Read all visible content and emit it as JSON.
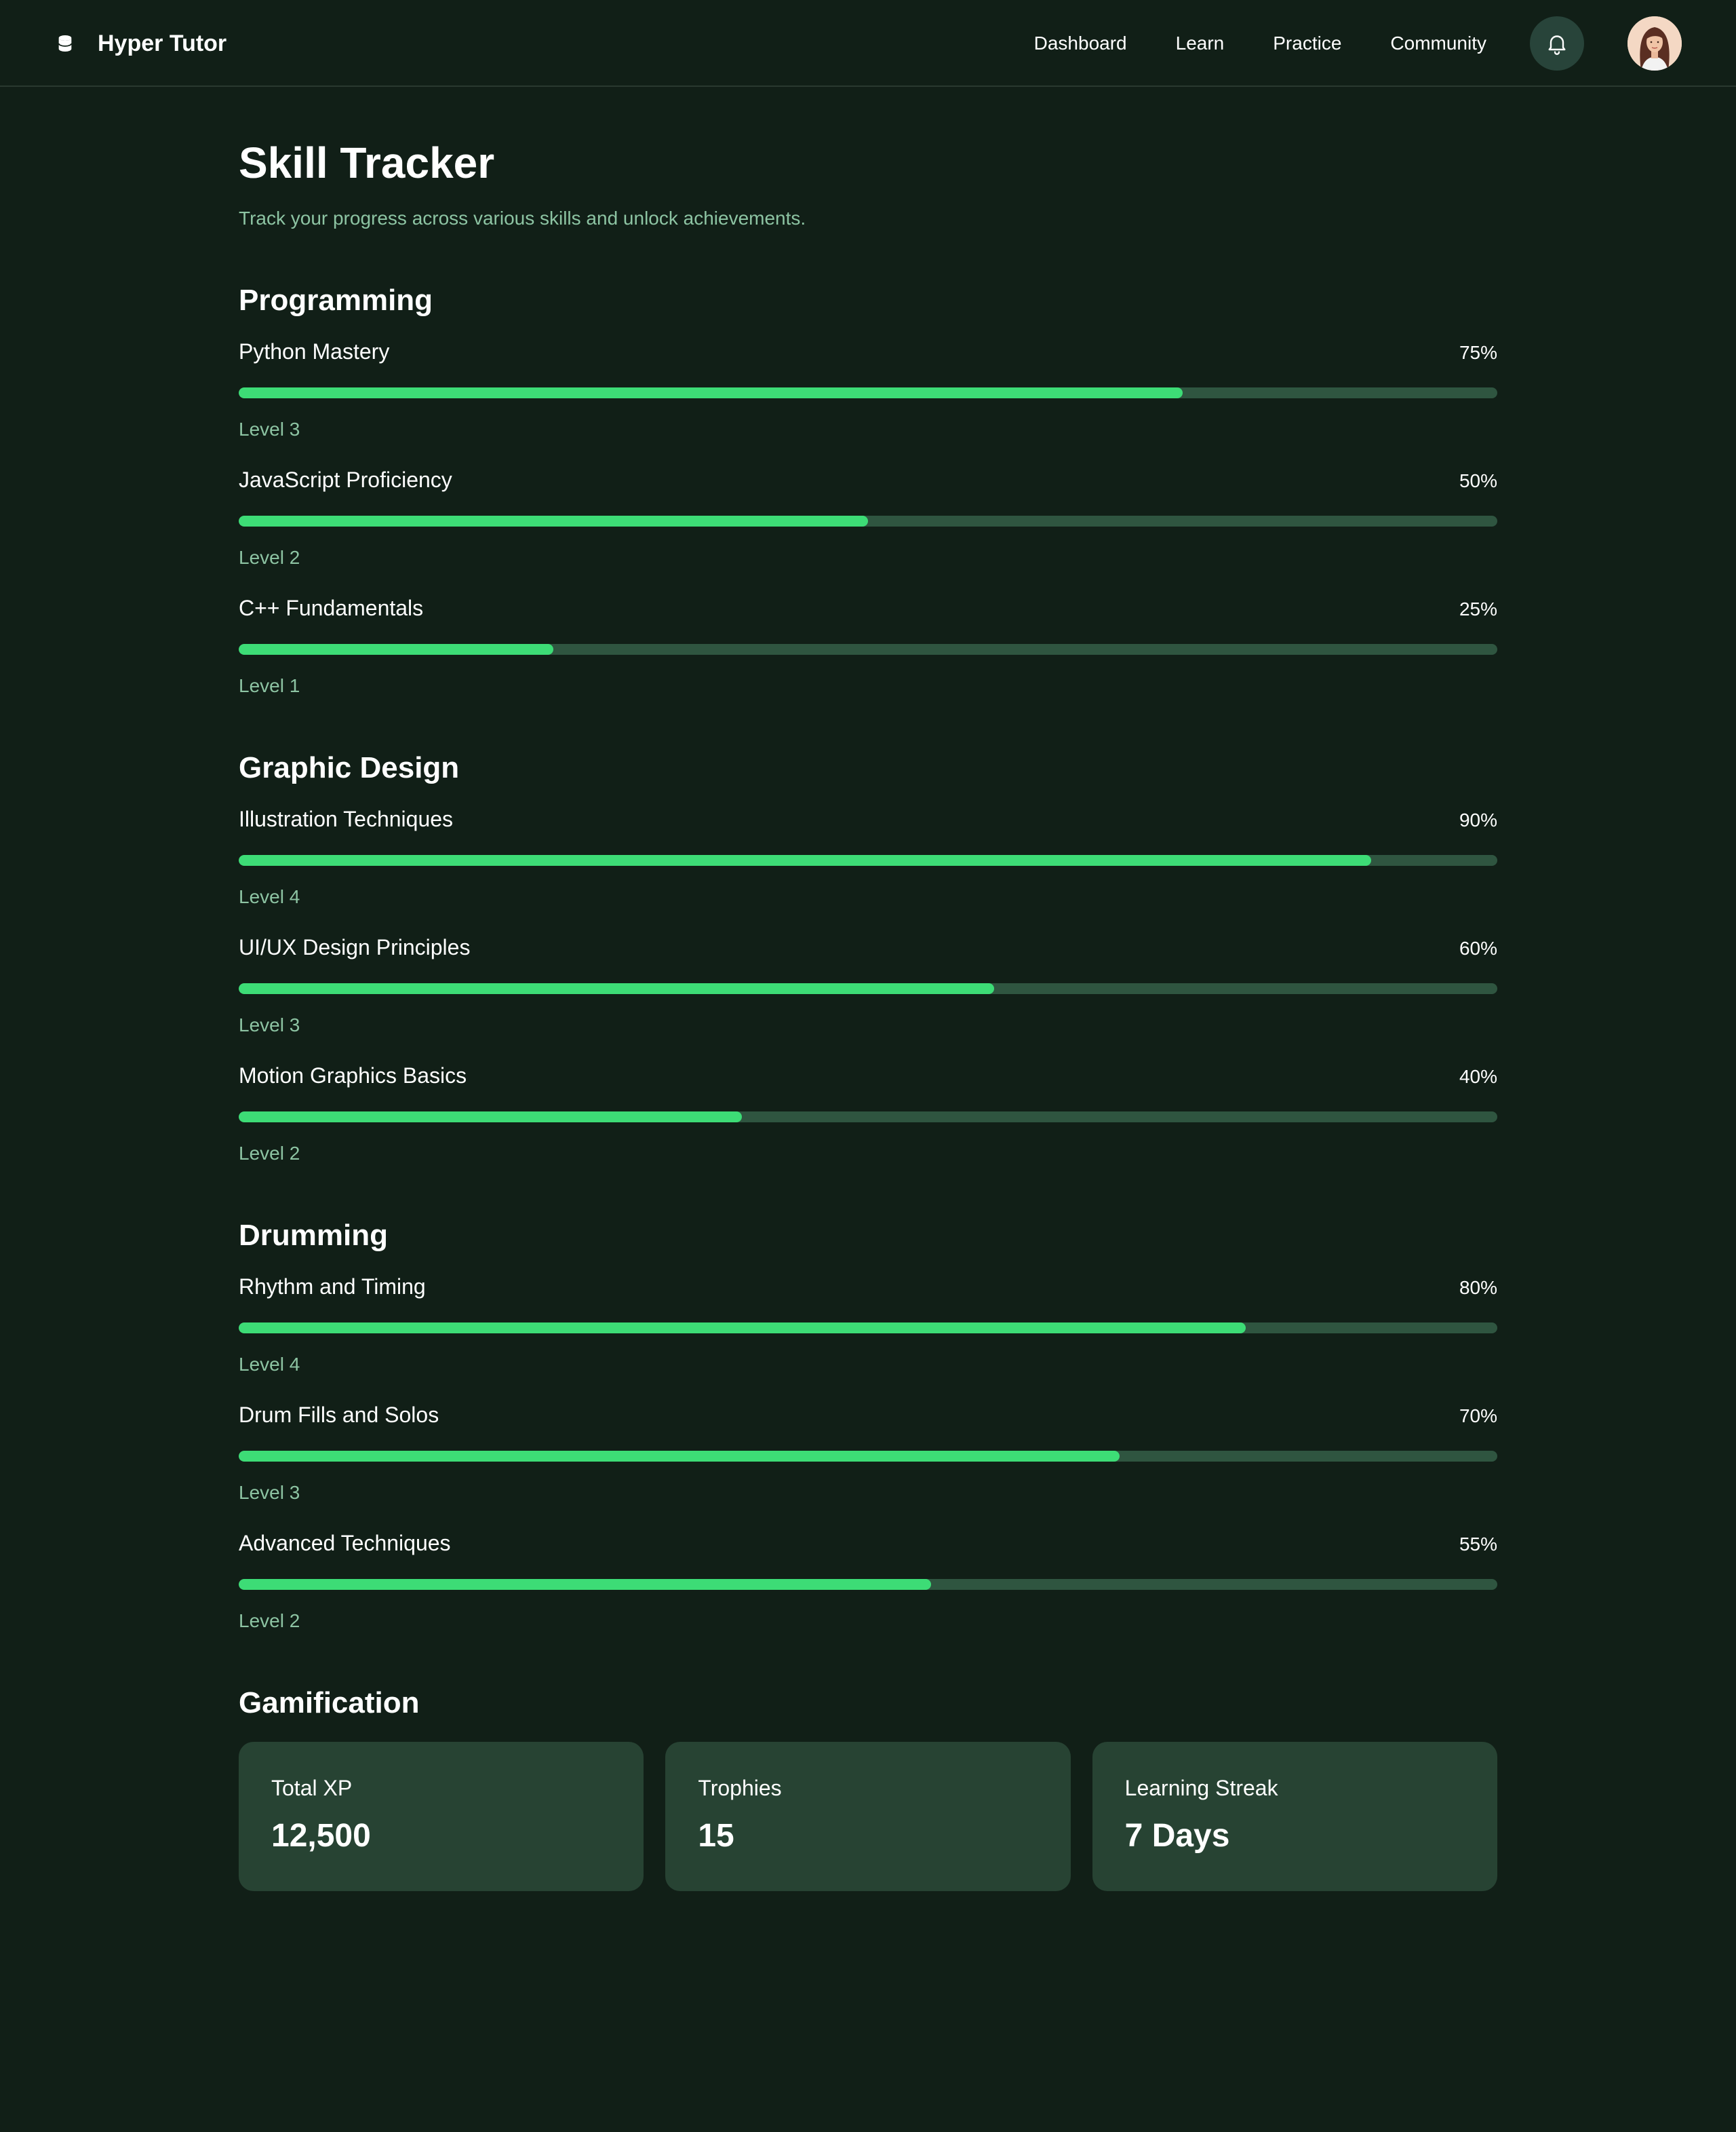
{
  "header": {
    "brand": "Hyper Tutor",
    "brand_icon": "database-icon",
    "nav": [
      "Dashboard",
      "Learn",
      "Practice",
      "Community"
    ],
    "notification_icon": "bell-icon"
  },
  "page": {
    "title": "Skill Tracker",
    "subtitle": "Track your progress across various skills and unlock achievements."
  },
  "colors": {
    "background": "#111f17",
    "accent": "#3ddc76",
    "track": "#2f5540",
    "card": "#274333",
    "muted_text": "#8dc4a3"
  },
  "sections": [
    {
      "title": "Programming",
      "skills": [
        {
          "name": "Python Mastery",
          "percent_label": "75%",
          "progress": 75,
          "level": "Level 3"
        },
        {
          "name": "JavaScript Proficiency",
          "percent_label": "50%",
          "progress": 50,
          "level": "Level 2"
        },
        {
          "name": "C++ Fundamentals",
          "percent_label": "25%",
          "progress": 25,
          "level": "Level 1"
        }
      ]
    },
    {
      "title": "Graphic Design",
      "skills": [
        {
          "name": "Illustration Techniques",
          "percent_label": "90%",
          "progress": 90,
          "level": "Level 4"
        },
        {
          "name": "UI/UX Design Principles",
          "percent_label": "60%",
          "progress": 60,
          "level": "Level 3"
        },
        {
          "name": "Motion Graphics Basics",
          "percent_label": "40%",
          "progress": 40,
          "level": "Level 2"
        }
      ]
    },
    {
      "title": "Drumming",
      "skills": [
        {
          "name": "Rhythm and Timing",
          "percent_label": "80%",
          "progress": 80,
          "level": "Level 4"
        },
        {
          "name": "Drum Fills and Solos",
          "percent_label": "70%",
          "progress": 70,
          "level": "Level 3"
        },
        {
          "name": "Advanced Techniques",
          "percent_label": "55%",
          "progress": 55,
          "level": "Level 2"
        }
      ]
    }
  ],
  "gamification": {
    "title": "Gamification",
    "cards": [
      {
        "label": "Total XP",
        "value": "12,500"
      },
      {
        "label": "Trophies",
        "value": "15"
      },
      {
        "label": "Learning Streak",
        "value": "7 Days"
      }
    ]
  }
}
